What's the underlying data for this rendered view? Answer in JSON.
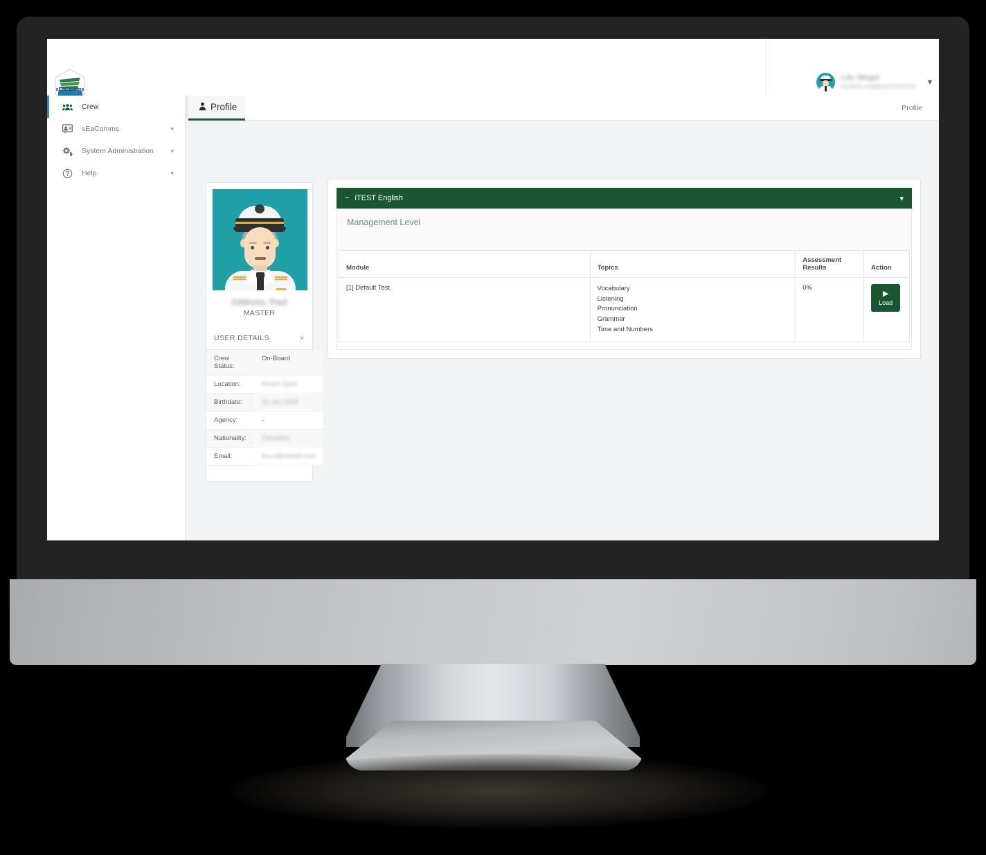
{
  "app": {
    "brand_name": "sEaComms",
    "logo_text": "sEaComms"
  },
  "topbar": {
    "user_name": "Lds. Weigel",
    "user_role": "SUPER ADMINISTRATOR",
    "caret_icon": "chevron-down-icon"
  },
  "tabstrip": {
    "menu_toggle_icon": "hamburger-menu-icon",
    "profile_tab_label": "Profile",
    "profile_tab_icon": "user-tie-icon",
    "breadcrumb": "Profile"
  },
  "sidebar": {
    "items": [
      {
        "label": "Crew",
        "icon": "users-icon",
        "active": true,
        "expandable": false
      },
      {
        "label": "sEaComms",
        "icon": "chat-box-icon",
        "active": false,
        "expandable": true
      },
      {
        "label": "System Administration",
        "icon": "gears-icon",
        "active": false,
        "expandable": true
      },
      {
        "label": "Help",
        "icon": "question-circle-icon",
        "active": false,
        "expandable": true
      }
    ]
  },
  "profile_card": {
    "photo_alt": "captain-avatar",
    "name": "Gibbons, Paul",
    "rank": "MASTER",
    "details_title": "USER DETAILS",
    "close_icon": "close-icon",
    "details": [
      {
        "key": "Crew Status:",
        "value": "On-Board",
        "redacted": false
      },
      {
        "key": "Location:",
        "value": "Hirsch Spirit",
        "redacted": true
      },
      {
        "key": "Birthdate:",
        "value": "21 Jan 1968",
        "redacted": true
      },
      {
        "key": "Agency:",
        "value": "-",
        "redacted": false
      },
      {
        "key": "Nationality:",
        "value": "Canadian",
        "redacted": true
      },
      {
        "key": "Email:",
        "value": "his.p@misted.com",
        "redacted": true
      }
    ]
  },
  "assessment": {
    "accordion_label": "iTEST English",
    "accordion_collapse_icon": "minus-icon",
    "accordion_caret_icon": "caret-down-icon",
    "level_title": "Management Level",
    "columns": [
      "Module",
      "Topics",
      "Assessment Results",
      "Action"
    ],
    "column_assess_line1": "Assessment",
    "column_assess_line2": "Results",
    "rows": [
      {
        "module": "[1] Default Test",
        "topics": [
          "Vocabulary",
          "Listening",
          "Pronunciation",
          "Grammar",
          "Time and Numbers"
        ],
        "result": "0%",
        "action_label": "Load",
        "action_icon": "play-icon"
      }
    ]
  },
  "colors": {
    "brand_green": "#1a5632",
    "accent_blue": "#2e86c8",
    "avatar_teal": "#22a0a8",
    "content_bg": "#f2f3f5"
  }
}
